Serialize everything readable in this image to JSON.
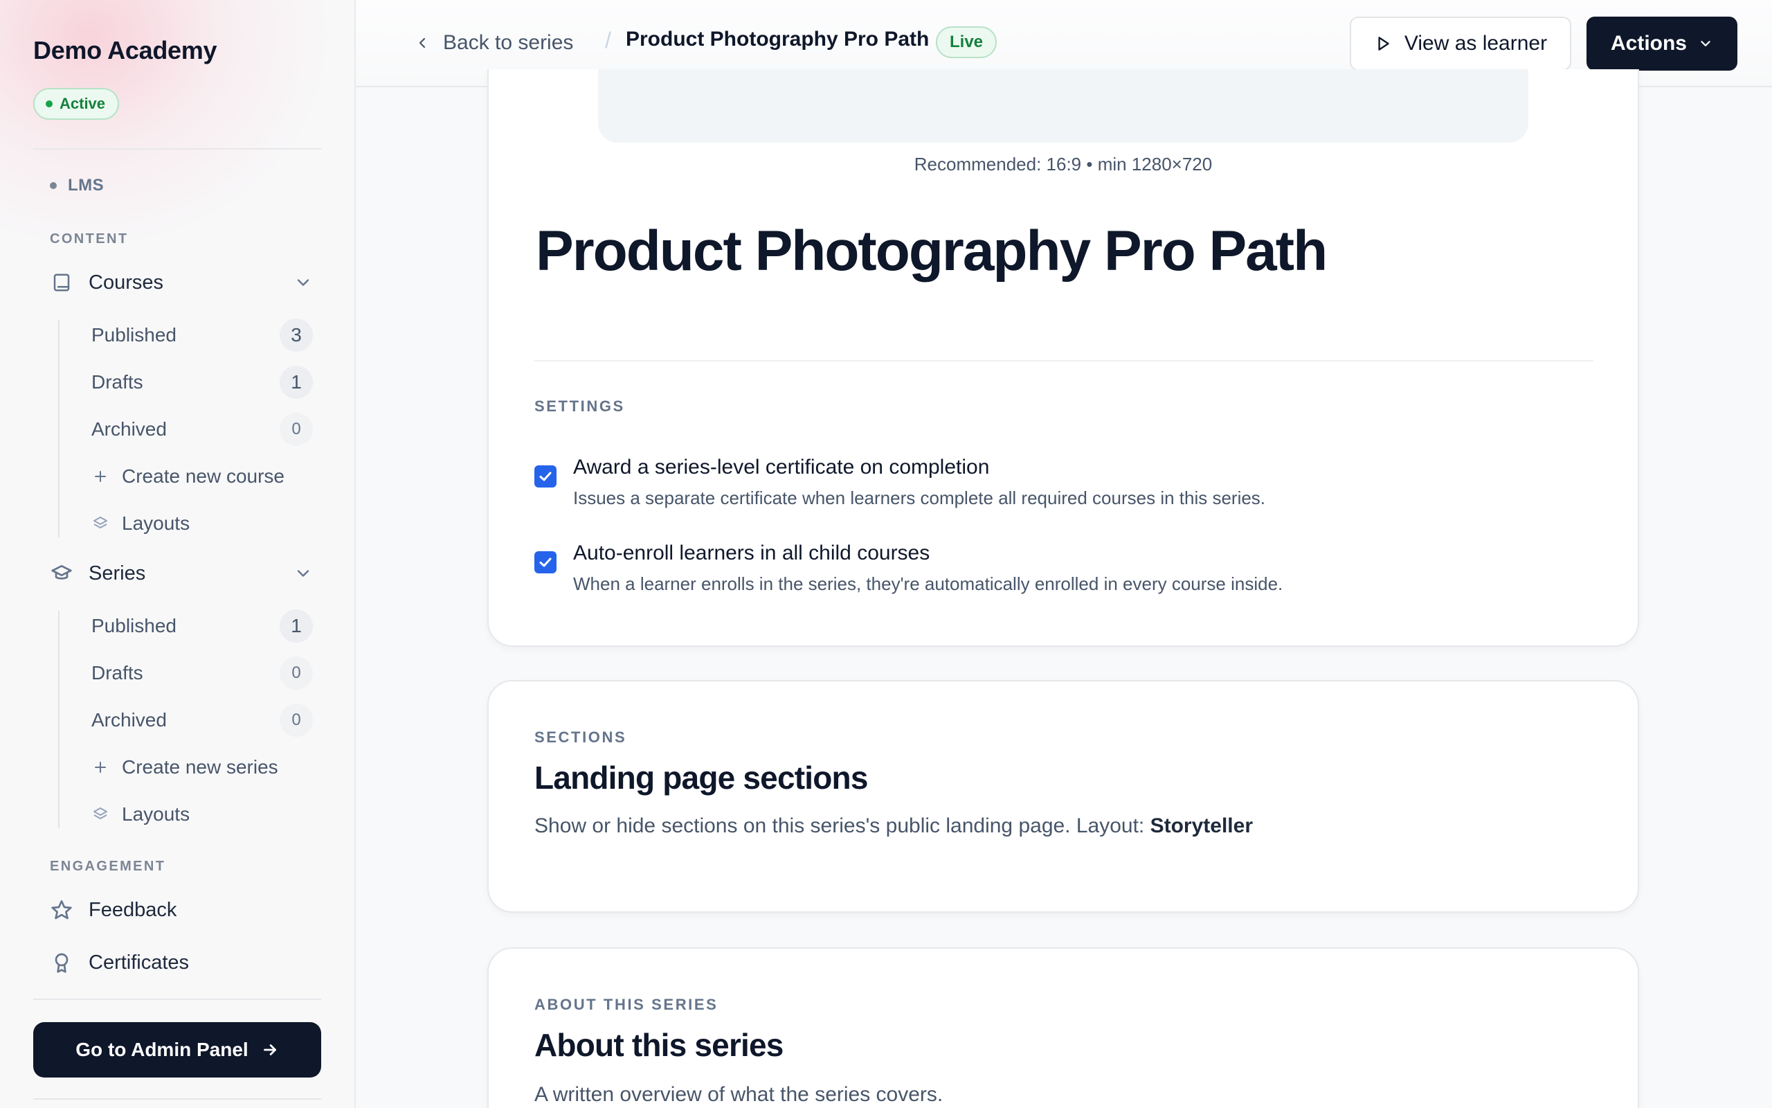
{
  "sidebar": {
    "brand": "Demo Academy",
    "status": "Active",
    "lms_label": "LMS",
    "content_label": "CONTENT",
    "courses": {
      "label": "Courses",
      "items": [
        {
          "label": "Published",
          "count": "3"
        },
        {
          "label": "Drafts",
          "count": "1"
        },
        {
          "label": "Archived",
          "count": "0"
        }
      ],
      "create_label": "Create new course",
      "layouts_label": "Layouts"
    },
    "series": {
      "label": "Series",
      "items": [
        {
          "label": "Published",
          "count": "1"
        },
        {
          "label": "Drafts",
          "count": "0"
        },
        {
          "label": "Archived",
          "count": "0"
        }
      ],
      "create_label": "Create new series",
      "layouts_label": "Layouts"
    },
    "engagement_label": "ENGAGEMENT",
    "feedback_label": "Feedback",
    "certificates_label": "Certificates",
    "admin_button": "Go to Admin Panel"
  },
  "topbar": {
    "back_label": "Back to series",
    "separator": "/",
    "title": "Product Photography Pro Path",
    "status": "Live",
    "view_learner": "View as learner",
    "actions": "Actions"
  },
  "editor": {
    "cover_hint": "Recommended: 16:9 • min 1280×720",
    "title": "Product Photography Pro Path",
    "settings_label": "SETTINGS",
    "settings": [
      {
        "title": "Award a series-level certificate on completion",
        "description": "Issues a separate certificate when learners complete all required courses in this series.",
        "checked": true
      },
      {
        "title": "Auto-enroll learners in all child courses",
        "description": "When a learner enrolls in the series, they're automatically enrolled in every course inside.",
        "checked": true
      }
    ]
  },
  "sections_card": {
    "eyebrow": "SECTIONS",
    "heading": "Landing page sections",
    "description": "Show or hide sections on this series's public landing page. Layout: ",
    "layout_name": "Storyteller"
  },
  "about_card": {
    "eyebrow": "ABOUT THIS SERIES",
    "heading": "About this series",
    "description": "A written overview of what the series covers."
  },
  "colors": {
    "primary_dark": "#0f172a",
    "accent_blue": "#2563eb",
    "success_green": "#15803d"
  }
}
